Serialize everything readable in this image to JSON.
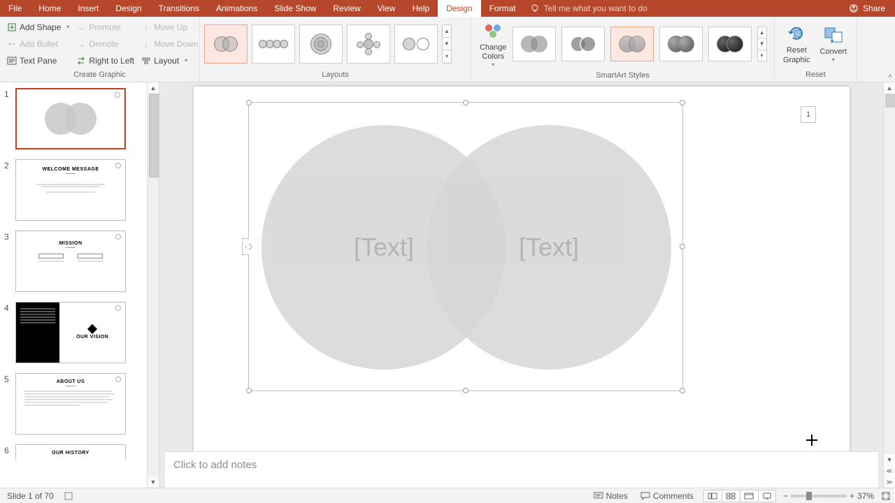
{
  "menu": {
    "tabs": [
      "File",
      "Home",
      "Insert",
      "Design",
      "Transitions",
      "Animations",
      "Slide Show",
      "Review",
      "View",
      "Help"
    ],
    "context_tabs": [
      "Design",
      "Format"
    ],
    "active_context": "Design",
    "tell_me": "Tell me what you want to do",
    "share": "Share"
  },
  "ribbon": {
    "create_graphic": {
      "label": "Create Graphic",
      "add_shape": "Add Shape",
      "add_bullet": "Add Bullet",
      "text_pane": "Text Pane",
      "promote": "Promote",
      "demote": "Demote",
      "right_to_left": "Right to Left",
      "move_up": "Move Up",
      "move_down": "Move Down",
      "layout": "Layout"
    },
    "layouts": {
      "label": "Layouts"
    },
    "change_colors": "Change\nColors",
    "styles": {
      "label": "SmartArt Styles"
    },
    "reset": {
      "label": "Reset",
      "reset_graphic": "Reset\nGraphic",
      "convert": "Convert"
    }
  },
  "thumbnails": [
    {
      "n": "1",
      "title": "",
      "kind": "venn",
      "selected": true
    },
    {
      "n": "2",
      "title": "WELCOME MESSAGE",
      "kind": "text"
    },
    {
      "n": "3",
      "title": "MISSION",
      "kind": "boxes"
    },
    {
      "n": "4",
      "title": "OUR VISION",
      "kind": "split"
    },
    {
      "n": "5",
      "title": "ABOUT US",
      "kind": "para"
    },
    {
      "n": "6",
      "title": "OUR HISTORY",
      "kind": "strip"
    }
  ],
  "canvas": {
    "left_text": "[Text]",
    "right_text": "[Text]",
    "comment_id": "1"
  },
  "notes_placeholder": "Click to add notes",
  "status": {
    "slide": "Slide 1 of 70",
    "notes": "Notes",
    "comments": "Comments",
    "zoom": "37%"
  }
}
